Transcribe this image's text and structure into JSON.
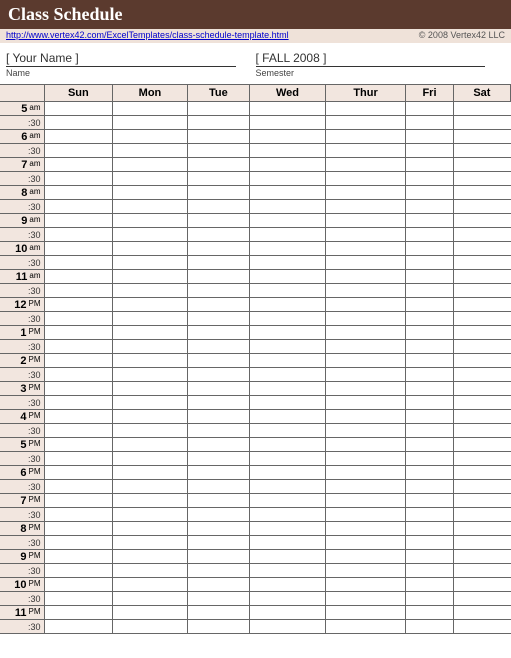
{
  "header": {
    "title": "Class Schedule"
  },
  "subheader": {
    "link": "http://www.vertex42.com/ExcelTemplates/class-schedule-template.html",
    "copyright": "© 2008 Vertex42 LLC"
  },
  "info": {
    "name_value": "[  Your Name  ]",
    "name_label": "Name",
    "semester_value": "[  FALL 2008  ]",
    "semester_label": "Semester"
  },
  "days": [
    "Sun",
    "Mon",
    "Tue",
    "Wed",
    "Thur",
    "Fri",
    "Sat"
  ],
  "hours": [
    {
      "hour": "5",
      "ampm": "am"
    },
    {
      "hour": "6",
      "ampm": "am"
    },
    {
      "hour": "7",
      "ampm": "am"
    },
    {
      "hour": "8",
      "ampm": "am"
    },
    {
      "hour": "9",
      "ampm": "am"
    },
    {
      "hour": "10",
      "ampm": "am"
    },
    {
      "hour": "11",
      "ampm": "am"
    },
    {
      "hour": "12",
      "ampm": "PM"
    },
    {
      "hour": "1",
      "ampm": "PM"
    },
    {
      "hour": "2",
      "ampm": "PM"
    },
    {
      "hour": "3",
      "ampm": "PM"
    },
    {
      "hour": "4",
      "ampm": "PM"
    },
    {
      "hour": "5",
      "ampm": "PM"
    },
    {
      "hour": "6",
      "ampm": "PM"
    },
    {
      "hour": "7",
      "ampm": "PM"
    },
    {
      "hour": "8",
      "ampm": "PM"
    },
    {
      "hour": "9",
      "ampm": "PM"
    },
    {
      "hour": "10",
      "ampm": "PM"
    },
    {
      "hour": "11",
      "ampm": "PM"
    }
  ],
  "halfLabel": ":30"
}
